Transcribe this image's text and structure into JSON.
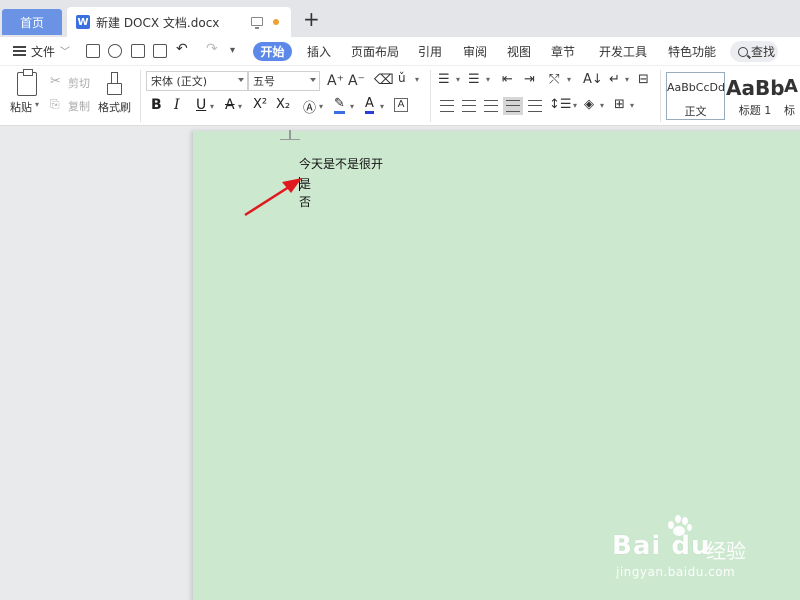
{
  "tabs": {
    "home": "首页",
    "doc_icon_letter": "W",
    "doc_title": "新建 DOCX 文档.docx",
    "add": "+"
  },
  "menu": {
    "file": "文件",
    "file_caret": "﹀",
    "items": [
      "开始",
      "插入",
      "页面布局",
      "引用",
      "审阅",
      "视图",
      "章节",
      "开发工具",
      "特色功能"
    ],
    "search": "查找"
  },
  "ribbon": {
    "paste": "粘贴",
    "cut": "剪切",
    "copy": "复制",
    "format_painter": "格式刷",
    "font_name": "宋体 (正文)",
    "font_size": "五号",
    "bold": "B",
    "italic": "I",
    "underline": "U",
    "strike": "A",
    "superscript": "X²",
    "subscript": "X₂",
    "font_color": "A",
    "grow_font": "A⁺",
    "shrink_font": "A⁻",
    "styles": [
      {
        "sample": "AaBbCcDd",
        "name": "正文"
      },
      {
        "sample": "AaBb",
        "name": "标题 1"
      },
      {
        "sample": "A",
        "name": "标"
      }
    ]
  },
  "document": {
    "lines": [
      "今天是不是很开",
      "是",
      "否"
    ]
  },
  "watermark": {
    "logo": "Bai  du",
    "cn": "经验",
    "url": "jingyan.baidu.com"
  },
  "colors": {
    "accent": "#5b88e9",
    "page_bg": "#cce8cf",
    "arrow": "#e0191e"
  }
}
